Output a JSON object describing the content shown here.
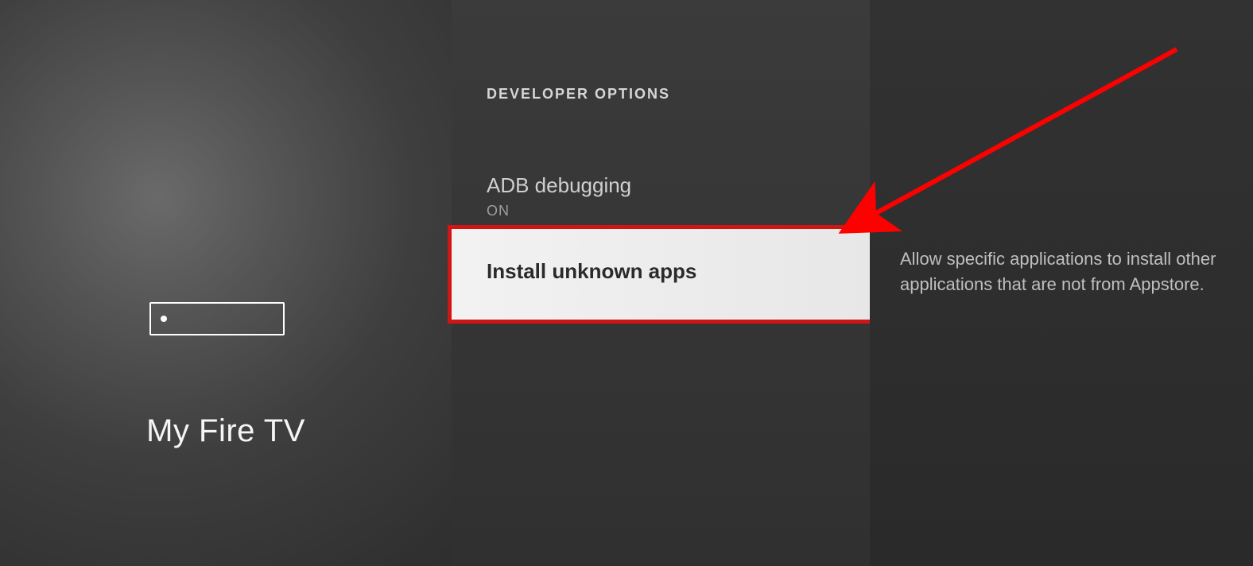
{
  "left": {
    "device_label": "My Fire TV"
  },
  "mid": {
    "section_title": "DEVELOPER OPTIONS",
    "options": [
      {
        "label": "ADB debugging",
        "value": "ON"
      },
      {
        "label": "Install unknown apps"
      }
    ]
  },
  "right": {
    "description": "Allow specific applications to install other applications that are not from Appstore."
  },
  "annotation": {
    "arrow_color": "#ff0000"
  }
}
